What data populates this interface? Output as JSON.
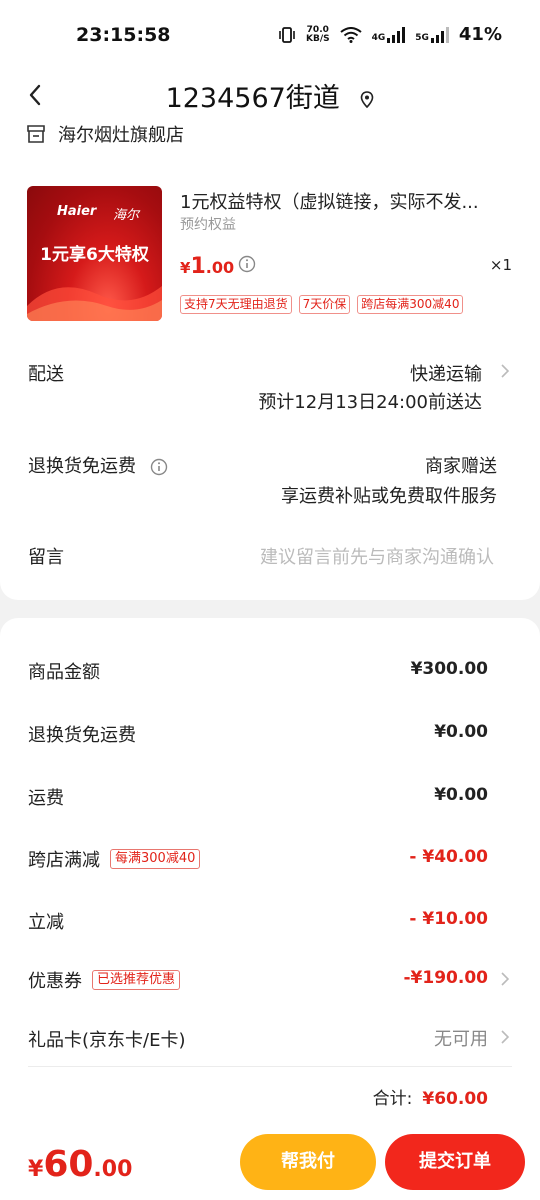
{
  "status": {
    "time": "23:15:58",
    "net_speed_top": "70.0",
    "net_speed_bottom": "KB/S",
    "gen1": "4G",
    "gen2": "5G",
    "battery": "41%"
  },
  "nav": {
    "title": "1234567街道"
  },
  "shop": {
    "name": "海尔烟灶旗舰店"
  },
  "product": {
    "thumb_brand": "Haier",
    "thumb_brand_cn": "海尔",
    "thumb_promo": "1元享6大特权",
    "title": "1元权益特权（虚拟链接，实际不发...",
    "subtitle": "预约权益",
    "price_currency": "¥",
    "price_int": "1",
    "price_dec": ".00",
    "qty": "×1",
    "tags": [
      "支持7天无理由退货",
      "7天价保",
      "跨店每满300减40"
    ]
  },
  "delivery": {
    "label": "配送",
    "value": "快递运输",
    "eta": "预计12月13日24:00前送达"
  },
  "return_shipping": {
    "label": "退换货免运费",
    "value": "商家赠送",
    "desc": "享运费补贴或免费取件服务"
  },
  "message": {
    "label": "留言",
    "placeholder": "建议留言前先与商家沟通确认"
  },
  "summary": {
    "goods_label": "商品金额",
    "goods_amount": "¥300.00",
    "return_label": "退换货免运费",
    "return_amount": "¥0.00",
    "freight_label": "运费",
    "freight_amount": "¥0.00",
    "cross_label": "跨店满减",
    "cross_badge": "每满300减40",
    "cross_amount": "- ¥40.00",
    "instant_label": "立减",
    "instant_amount": "- ¥10.00",
    "coupon_label": "优惠券",
    "coupon_badge": "已选推荐优惠",
    "coupon_amount": "-¥190.00",
    "giftcard_label": "礼品卡(京东卡/E卡)",
    "giftcard_value": "无可用",
    "total_label": "合计:",
    "total_amount": "¥60.00"
  },
  "bottom": {
    "currency": "¥",
    "int": "60",
    "dec": ".00",
    "help_label": "帮我付",
    "submit_label": "提交订单"
  },
  "colors": {
    "accent_red": "#e2231a",
    "help_button": "#ffb315",
    "submit_button": "#f2271c"
  }
}
